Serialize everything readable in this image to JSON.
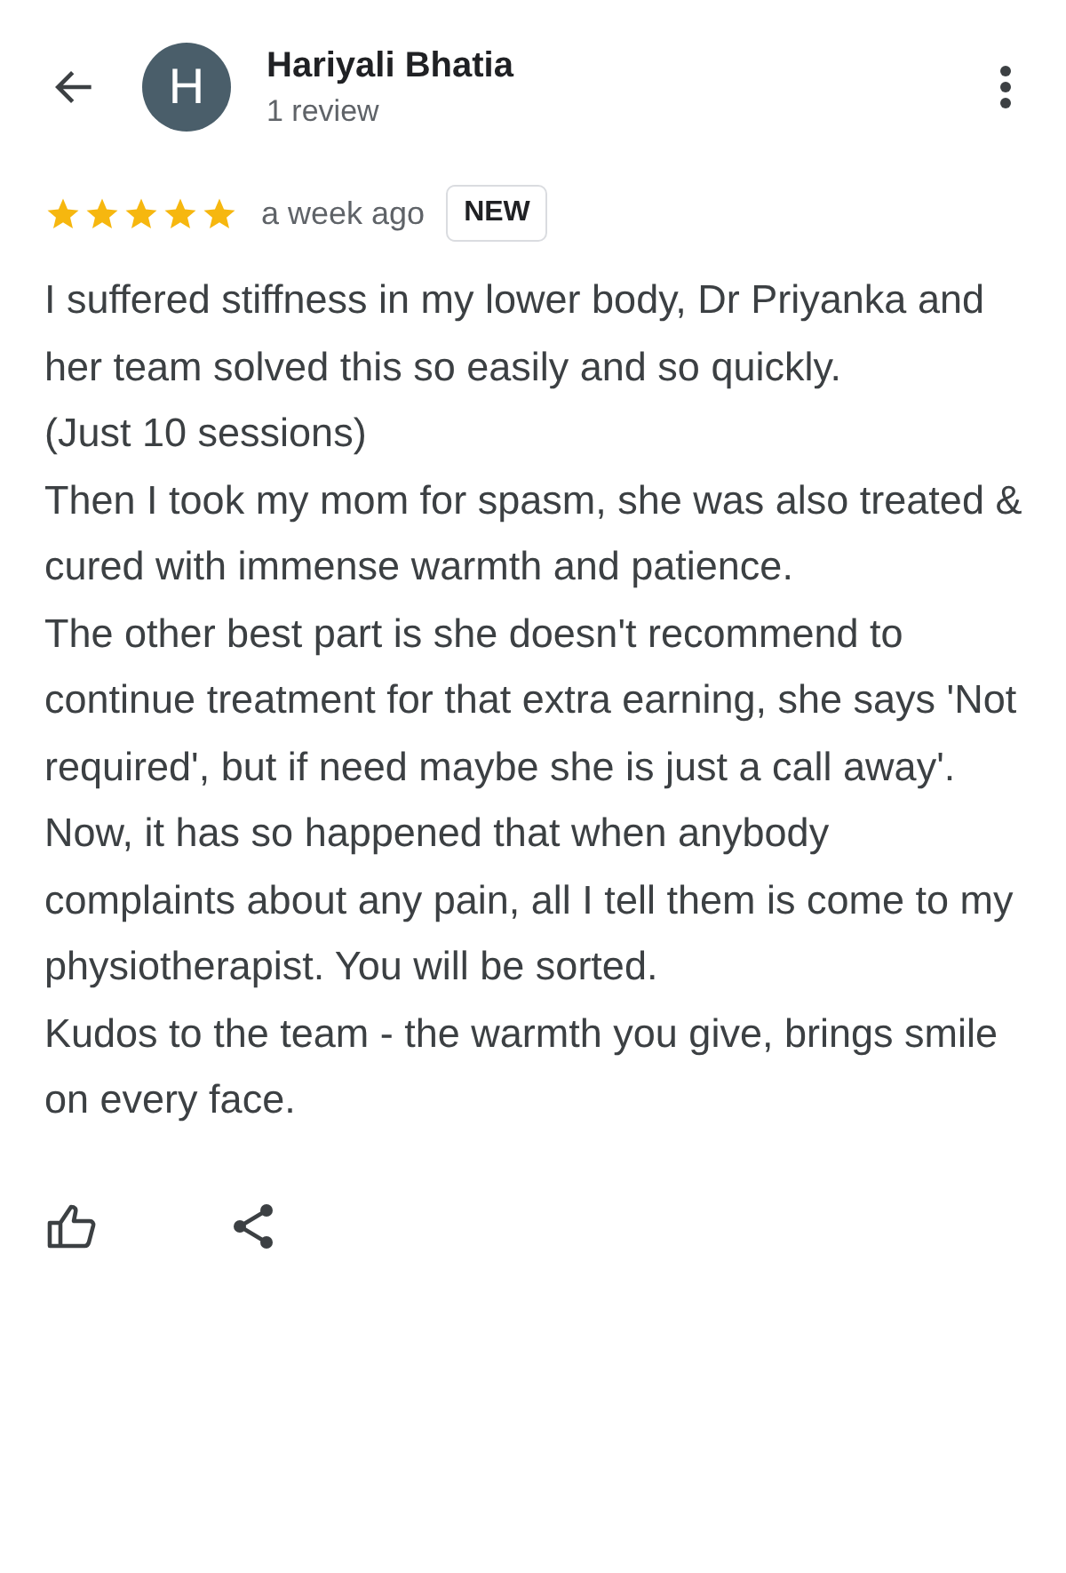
{
  "header": {
    "avatar_letter": "H",
    "name": "Hariyali Bhatia",
    "review_count": "1 review"
  },
  "review": {
    "stars": 5,
    "time": "a week ago",
    "badge": "NEW",
    "paragraphs": [
      "I suffered stiffness in my lower body, Dr Priyanka and her team solved this so easily and so quickly.",
      "(Just 10 sessions)",
      "Then I took my mom for spasm, she was also treated & cured with immense warmth and patience.",
      "The other best part is she doesn't recommend to continue treatment for that extra earning, she says 'Not required', but if need maybe she is just a call away'.",
      "Now, it has so happened that when anybody complaints about any pain, all I tell them is come to my physiotherapist. You will be sorted.",
      "Kudos to the team - the warmth you give, brings smile on every face."
    ]
  }
}
